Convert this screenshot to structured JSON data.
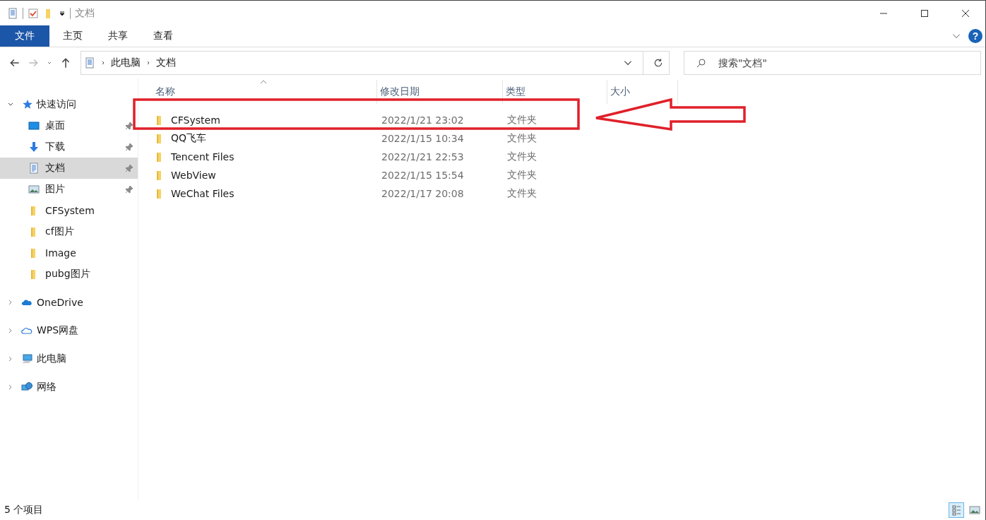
{
  "window": {
    "title": "文档"
  },
  "ribbon": {
    "tabs": [
      {
        "label": "文件",
        "selected": true
      },
      {
        "label": "主页",
        "selected": false
      },
      {
        "label": "共享",
        "selected": false
      },
      {
        "label": "查看",
        "selected": false
      }
    ]
  },
  "address": {
    "crumbs": [
      "此电脑",
      "文档"
    ]
  },
  "help": {
    "label": "?"
  },
  "search": {
    "placeholder": "搜索\"文档\""
  },
  "sidebar": {
    "items": [
      {
        "label": "快速访问",
        "kind": "star",
        "expanded": true,
        "selected": false,
        "children": [
          {
            "label": "桌面",
            "kind": "desktop",
            "pinned": true,
            "selected": false
          },
          {
            "label": "下载",
            "kind": "download",
            "pinned": true,
            "selected": false
          },
          {
            "label": "文档",
            "kind": "document",
            "pinned": true,
            "selected": true
          },
          {
            "label": "图片",
            "kind": "pictures",
            "pinned": true,
            "selected": false
          },
          {
            "label": "CFSystem",
            "kind": "folder",
            "pinned": false,
            "selected": false
          },
          {
            "label": "cf图片",
            "kind": "folder",
            "pinned": false,
            "selected": false
          },
          {
            "label": "Image",
            "kind": "folder",
            "pinned": false,
            "selected": false
          },
          {
            "label": "pubg图片",
            "kind": "folder",
            "pinned": false,
            "selected": false
          }
        ]
      },
      {
        "label": "OneDrive",
        "kind": "cloud",
        "expanded": false,
        "selected": false
      },
      {
        "label": "WPS网盘",
        "kind": "cloud-outline",
        "expanded": false,
        "selected": false
      },
      {
        "label": "此电脑",
        "kind": "computer",
        "expanded": false,
        "selected": false
      },
      {
        "label": "网络",
        "kind": "network",
        "expanded": false,
        "selected": false
      }
    ]
  },
  "table": {
    "columns": [
      "名称",
      "修改日期",
      "类型",
      "大小"
    ],
    "rows": [
      {
        "name": "CFSystem",
        "date": "2022/1/21 23:02",
        "type": "文件夹"
      },
      {
        "name": "QQ飞车",
        "date": "2022/1/15 10:34",
        "type": "文件夹"
      },
      {
        "name": "Tencent Files",
        "date": "2022/1/21 22:53",
        "type": "文件夹"
      },
      {
        "name": "WebView",
        "date": "2022/1/15 15:54",
        "type": "文件夹"
      },
      {
        "name": "WeChat Files",
        "date": "2022/1/17 20:08",
        "type": "文件夹"
      }
    ]
  },
  "status_bar": {
    "count": "5 个项目",
    "views": [
      {
        "kind": "details",
        "selected": true
      },
      {
        "kind": "large-icons",
        "selected": false
      }
    ]
  }
}
